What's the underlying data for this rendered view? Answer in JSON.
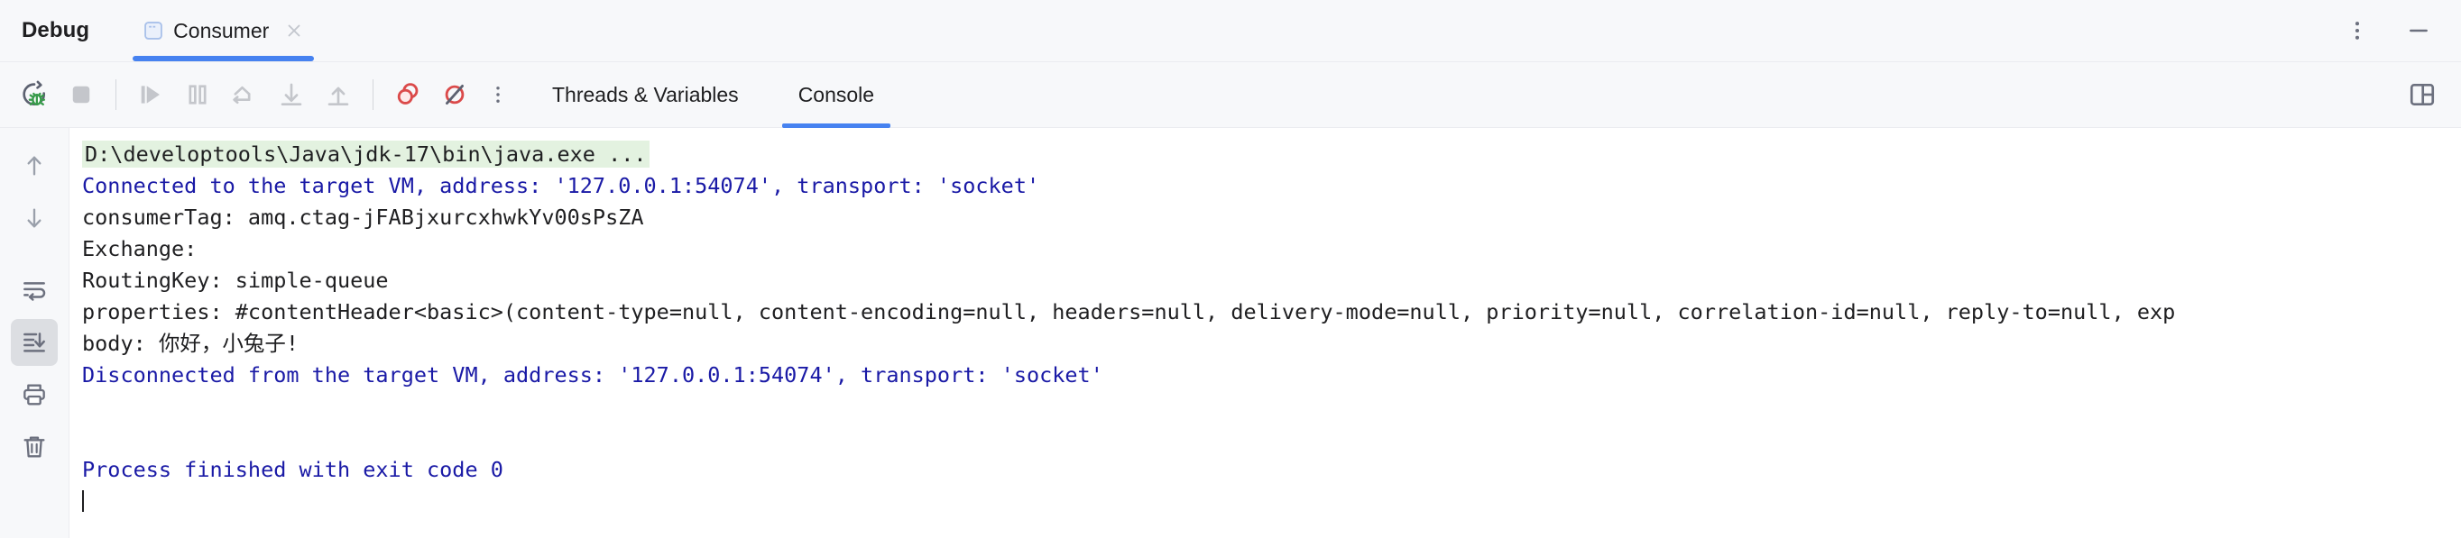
{
  "titlebar": {
    "panel_title": "Debug",
    "tab": {
      "label": "Consumer",
      "icon": "java-class-icon",
      "close_icon": "close-icon"
    },
    "more_options_icon": "vertical-dots-icon",
    "minimize_icon": "minimize-icon"
  },
  "toolbar": {
    "buttons": [
      {
        "name": "rerun-debug-button",
        "icon": "rerun-debug-icon",
        "label": "Rerun Debug",
        "enabled": true
      },
      {
        "name": "stop-button",
        "icon": "stop-square-icon",
        "label": "Stop",
        "enabled": true
      },
      {
        "name": "resume-program-button",
        "icon": "resume-icon",
        "label": "Resume Program",
        "enabled": false
      },
      {
        "name": "pause-program-button",
        "icon": "pause-icon",
        "label": "Pause Program",
        "enabled": false
      },
      {
        "name": "step-over-button",
        "icon": "step-over-icon",
        "label": "Step Over",
        "enabled": false
      },
      {
        "name": "step-into-button",
        "icon": "step-into-icon",
        "label": "Step Into",
        "enabled": false
      },
      {
        "name": "step-out-button",
        "icon": "step-out-icon",
        "label": "Step Out",
        "enabled": false
      },
      {
        "name": "view-breakpoints-button",
        "icon": "breakpoints-icon",
        "label": "View Breakpoints",
        "enabled": true
      },
      {
        "name": "mute-breakpoints-button",
        "icon": "mute-breakpoints-icon",
        "label": "Mute Breakpoints",
        "enabled": true
      }
    ],
    "more_icon": "vertical-dots-icon",
    "tabs": [
      {
        "label": "Threads & Variables",
        "active": false
      },
      {
        "label": "Console",
        "active": true
      }
    ],
    "layout_settings_icon": "layout-settings-icon"
  },
  "gutter": {
    "buttons": [
      {
        "name": "scroll-up-button",
        "icon": "arrow-up-icon",
        "active": false
      },
      {
        "name": "scroll-down-button",
        "icon": "arrow-down-icon",
        "active": false
      },
      {
        "name": "soft-wrap-button",
        "icon": "soft-wrap-icon",
        "active": false
      },
      {
        "name": "scroll-to-end-button",
        "icon": "scroll-to-end-icon",
        "active": true
      },
      {
        "name": "print-button",
        "icon": "printer-icon",
        "active": false
      },
      {
        "name": "clear-all-button",
        "icon": "trash-icon",
        "active": false
      }
    ]
  },
  "console": {
    "lines": [
      {
        "text": "D:\\developtools\\Java\\jdk-17\\bin\\java.exe ...",
        "style": "highlight"
      },
      {
        "text": "Connected to the target VM, address: '127.0.0.1:54074', transport: 'socket'",
        "style": "link"
      },
      {
        "text": "consumerTag: amq.ctag-jFABjxurcxhwkYv00sPsZA",
        "style": "plain"
      },
      {
        "text": "Exchange:",
        "style": "plain"
      },
      {
        "text": "RoutingKey: simple-queue",
        "style": "plain"
      },
      {
        "text": "properties: #contentHeader<basic>(content-type=null, content-encoding=null, headers=null, delivery-mode=null, priority=null, correlation-id=null, reply-to=null, exp",
        "style": "plain"
      },
      {
        "text": "body: 你好，小兔子!",
        "style": "plain"
      },
      {
        "text": "Disconnected from the target VM, address: '127.0.0.1:54074', transport: 'socket'",
        "style": "link"
      },
      {
        "text": "",
        "style": "blank"
      },
      {
        "text": "",
        "style": "blank"
      },
      {
        "text": "Process finished with exit code 0",
        "style": "link"
      },
      {
        "text": "",
        "style": "caret"
      }
    ]
  },
  "colors": {
    "accent": "#4682f0",
    "chrome": "#f7f8fa",
    "console_bg": "#ffffff",
    "link_text": "#1a1aa6",
    "plain_text": "#1f1f21",
    "highlight_bg": "#e3f2e0",
    "breakpoint_red": "#db5c5c",
    "debug_green": "#389b4b",
    "disabled_gray": "#c4c6cb",
    "icon_gray": "#6c707e"
  }
}
